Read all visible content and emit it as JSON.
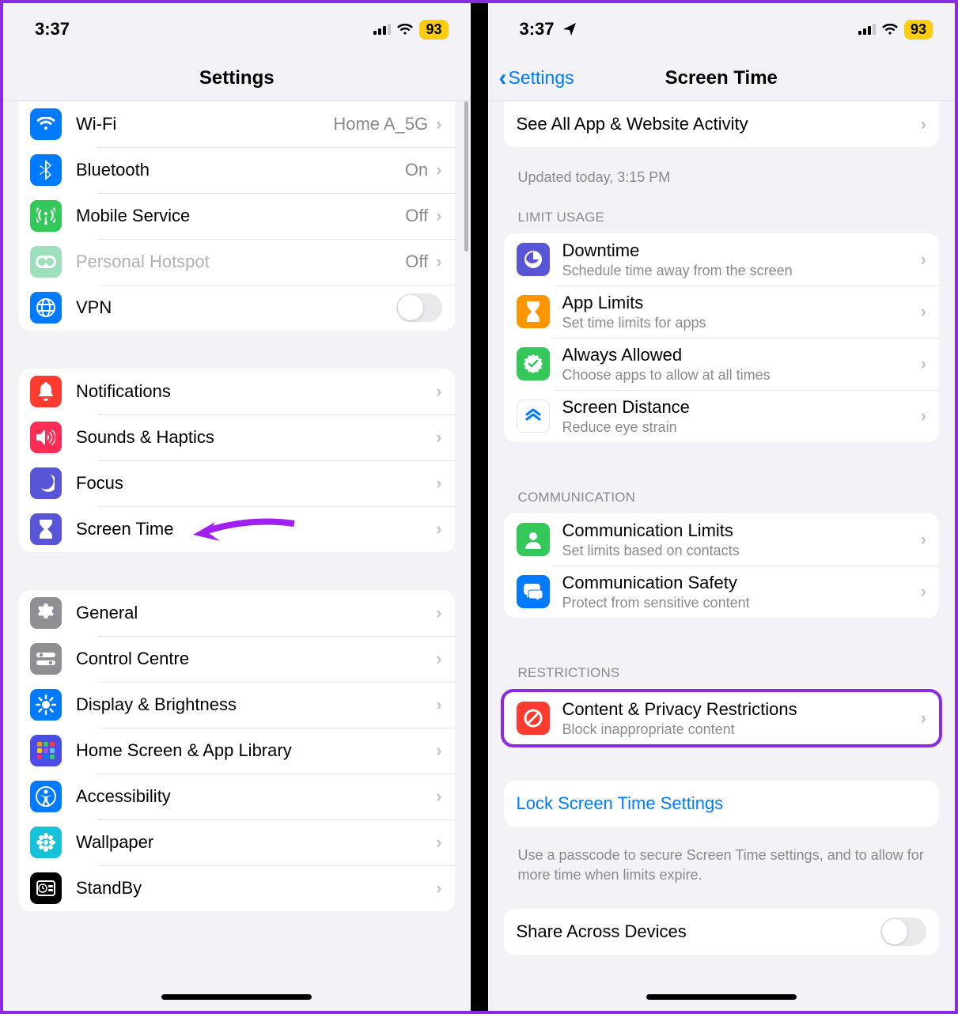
{
  "status": {
    "time": "3:37",
    "battery": "93"
  },
  "left": {
    "nav_title": "Settings",
    "connectivity": [
      {
        "key": "wifi",
        "label": "Wi-Fi",
        "value": "Home A_5G",
        "color": "#007aff",
        "chevron": true
      },
      {
        "key": "bluetooth",
        "label": "Bluetooth",
        "value": "On",
        "color": "#007aff",
        "chevron": true
      },
      {
        "key": "mobile",
        "label": "Mobile Service",
        "value": "Off",
        "color": "#34c759",
        "chevron": true
      },
      {
        "key": "hotspot",
        "label": "Personal Hotspot",
        "value": "Off",
        "color": "#9fe0bc",
        "chevron": true,
        "disabled": true
      },
      {
        "key": "vpn",
        "label": "VPN",
        "color": "#007aff",
        "toggle": true
      }
    ],
    "notifications": [
      {
        "key": "notifications",
        "label": "Notifications",
        "color": "#ff3b30"
      },
      {
        "key": "sounds",
        "label": "Sounds & Haptics",
        "color": "#ff2d55"
      },
      {
        "key": "focus",
        "label": "Focus",
        "color": "#5856d6"
      },
      {
        "key": "screentime",
        "label": "Screen Time",
        "color": "#5856d6"
      }
    ],
    "general": [
      {
        "key": "general",
        "label": "General",
        "color": "#8e8e93"
      },
      {
        "key": "control",
        "label": "Control Centre",
        "color": "#8e8e93"
      },
      {
        "key": "display",
        "label": "Display & Brightness",
        "color": "#007aff"
      },
      {
        "key": "home",
        "label": "Home Screen & App Library",
        "color": "#4b4ee6"
      },
      {
        "key": "accessibility",
        "label": "Accessibility",
        "color": "#007aff"
      },
      {
        "key": "wallpaper",
        "label": "Wallpaper",
        "color": "#17c1d9"
      },
      {
        "key": "standby",
        "label": "StandBy",
        "color": "#000"
      }
    ]
  },
  "right": {
    "nav_back": "Settings",
    "nav_title": "Screen Time",
    "activity_label": "See All App & Website Activity",
    "updated": "Updated today, 3:15 PM",
    "limit_header": "LIMIT USAGE",
    "limit": [
      {
        "key": "downtime",
        "title": "Downtime",
        "sub": "Schedule time away from the screen",
        "color": "#5856d6"
      },
      {
        "key": "applimits",
        "title": "App Limits",
        "sub": "Set time limits for apps",
        "color": "#ff9500"
      },
      {
        "key": "allowed",
        "title": "Always Allowed",
        "sub": "Choose apps to allow at all times",
        "color": "#34c759"
      },
      {
        "key": "distance",
        "title": "Screen Distance",
        "sub": "Reduce eye strain",
        "color": "#ffffff"
      }
    ],
    "comm_header": "COMMUNICATION",
    "comm": [
      {
        "key": "commlimits",
        "title": "Communication Limits",
        "sub": "Set limits based on contacts",
        "color": "#34c759"
      },
      {
        "key": "commsafety",
        "title": "Communication Safety",
        "sub": "Protect from sensitive content",
        "color": "#007aff"
      }
    ],
    "restr_header": "RESTRICTIONS",
    "restr": {
      "title": "Content & Privacy Restrictions",
      "sub": "Block inappropriate content",
      "color": "#ff3b30"
    },
    "lock_label": "Lock Screen Time Settings",
    "lock_footer": "Use a passcode to secure Screen Time settings, and to allow for more time when limits expire.",
    "share_label": "Share Across Devices"
  }
}
